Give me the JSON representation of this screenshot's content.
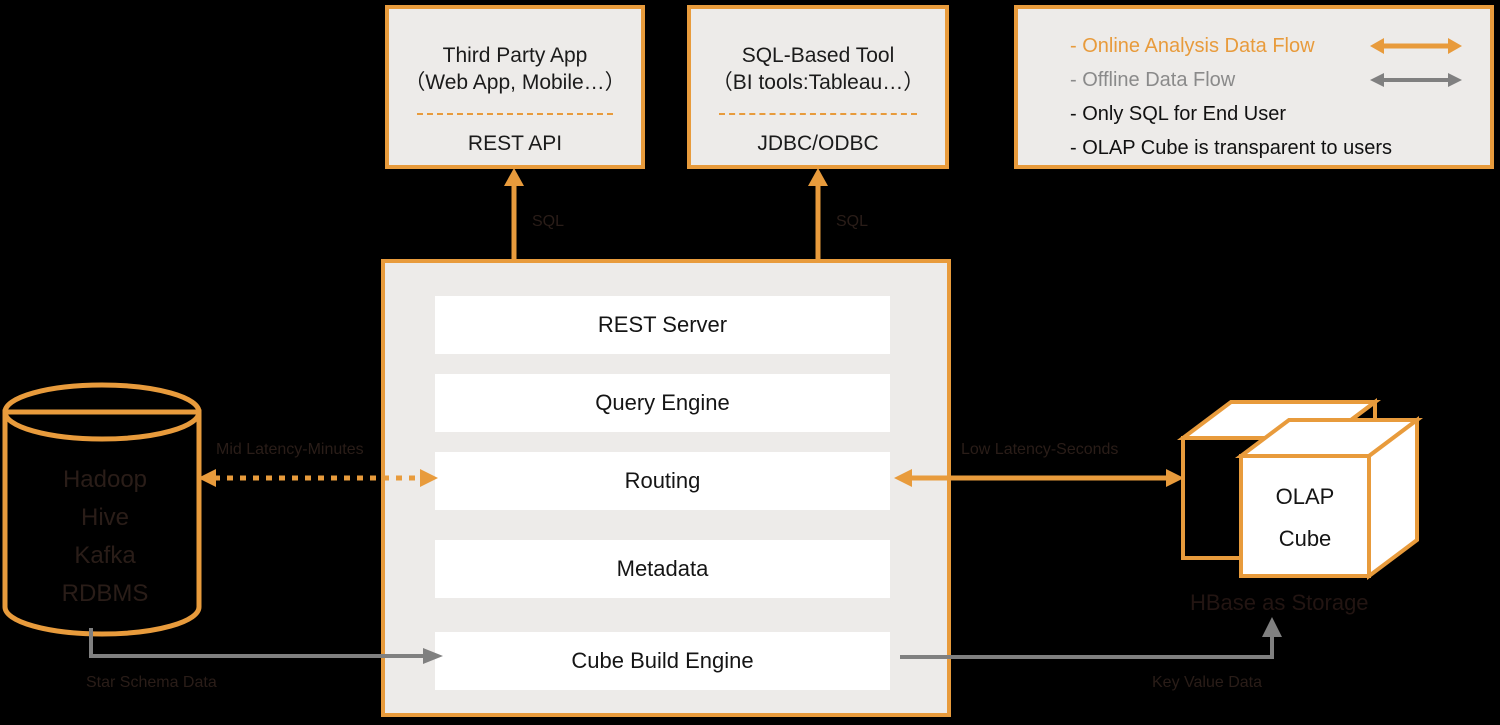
{
  "colors": {
    "orange": "#E89B3C",
    "gray": "#808080",
    "panel_fill": "#EDEBE9",
    "module_fill": "#FFFFFF",
    "background": "#000000"
  },
  "clients": [
    {
      "name": "third-party-app",
      "title": "Third Party App\n（Web App, Mobile…）",
      "protocol": "REST API"
    },
    {
      "name": "sql-based-tool",
      "title": "SQL-Based Tool\n（BI tools:Tableau…）",
      "protocol": "JDBC/ODBC"
    }
  ],
  "legend": {
    "items": [
      {
        "label": "- Online Analysis Data Flow",
        "color": "#E89B3C",
        "arrow": "bidirectional-arrow-orange"
      },
      {
        "label": "- Offline Data Flow",
        "color": "#808080",
        "arrow": "bidirectional-arrow-gray"
      },
      {
        "label": "- Only SQL for End User",
        "color": "#111111",
        "arrow": ""
      },
      {
        "label": "- OLAP Cube is transparent to users",
        "color": "#111111",
        "arrow": ""
      }
    ]
  },
  "kylin": {
    "modules": [
      "REST Server",
      "Query Engine",
      "Routing",
      "Metadata",
      "Cube Build Engine"
    ]
  },
  "source_store": {
    "label": "Hadoop\nHive\nKafka\nRDBMS"
  },
  "olap_store": {
    "cube_label": "OLAP\nCube",
    "storage_note": "HBase  as Storage"
  },
  "flow_labels": {
    "sql_left": "SQL",
    "sql_right": "SQL",
    "mid_latency": "Mid Latency-Minutes",
    "low_latency": "Low Latency-Seconds",
    "star_schema": "Star Schema Data",
    "key_value": "Key Value Data"
  }
}
